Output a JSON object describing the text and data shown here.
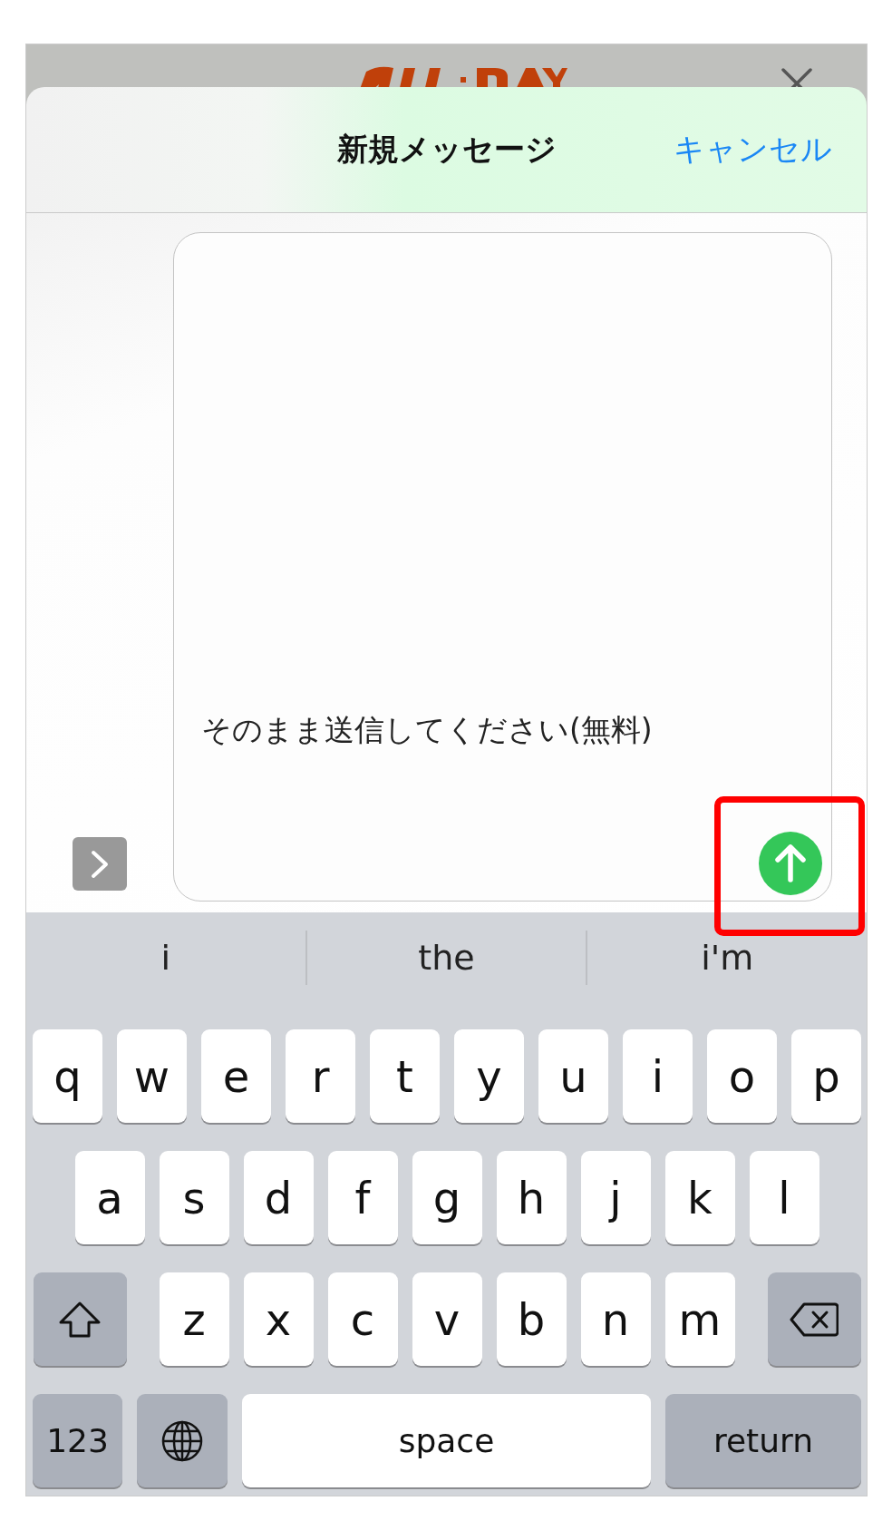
{
  "header": {
    "title": "新規メッセージ",
    "cancel": "キャンセル"
  },
  "message": {
    "text": "そのまま送信してください(無料)"
  },
  "suggestions": [
    {
      "label": "i"
    },
    {
      "label": "the"
    },
    {
      "label": "i'm"
    }
  ],
  "keyboard": {
    "letter_rows": [
      [
        {
          "kind": "letter",
          "label": "q"
        },
        {
          "kind": "letter",
          "label": "w"
        },
        {
          "kind": "letter",
          "label": "e"
        },
        {
          "kind": "letter",
          "label": "r"
        },
        {
          "kind": "letter",
          "label": "t"
        },
        {
          "kind": "letter",
          "label": "y"
        },
        {
          "kind": "letter",
          "label": "u"
        },
        {
          "kind": "letter",
          "label": "i"
        },
        {
          "kind": "letter",
          "label": "o"
        },
        {
          "kind": "letter",
          "label": "p"
        }
      ],
      [
        {
          "kind": "letter",
          "label": "a"
        },
        {
          "kind": "letter",
          "label": "s"
        },
        {
          "kind": "letter",
          "label": "d"
        },
        {
          "kind": "letter",
          "label": "f"
        },
        {
          "kind": "letter",
          "label": "g"
        },
        {
          "kind": "letter",
          "label": "h"
        },
        {
          "kind": "letter",
          "label": "j"
        },
        {
          "kind": "letter",
          "label": "k"
        },
        {
          "kind": "letter",
          "label": "l"
        }
      ],
      [
        {
          "kind": "shift"
        },
        {
          "kind": "letter",
          "label": "z"
        },
        {
          "kind": "letter",
          "label": "x"
        },
        {
          "kind": "letter",
          "label": "c"
        },
        {
          "kind": "letter",
          "label": "v"
        },
        {
          "kind": "letter",
          "label": "b"
        },
        {
          "kind": "letter",
          "label": "n"
        },
        {
          "kind": "letter",
          "label": "m"
        },
        {
          "kind": "delete"
        }
      ]
    ],
    "bottom_keys": [
      {
        "kind": "numbers",
        "label": "123"
      },
      {
        "kind": "globe"
      },
      {
        "kind": "space",
        "label": "space"
      },
      {
        "kind": "return",
        "label": "return"
      }
    ]
  }
}
